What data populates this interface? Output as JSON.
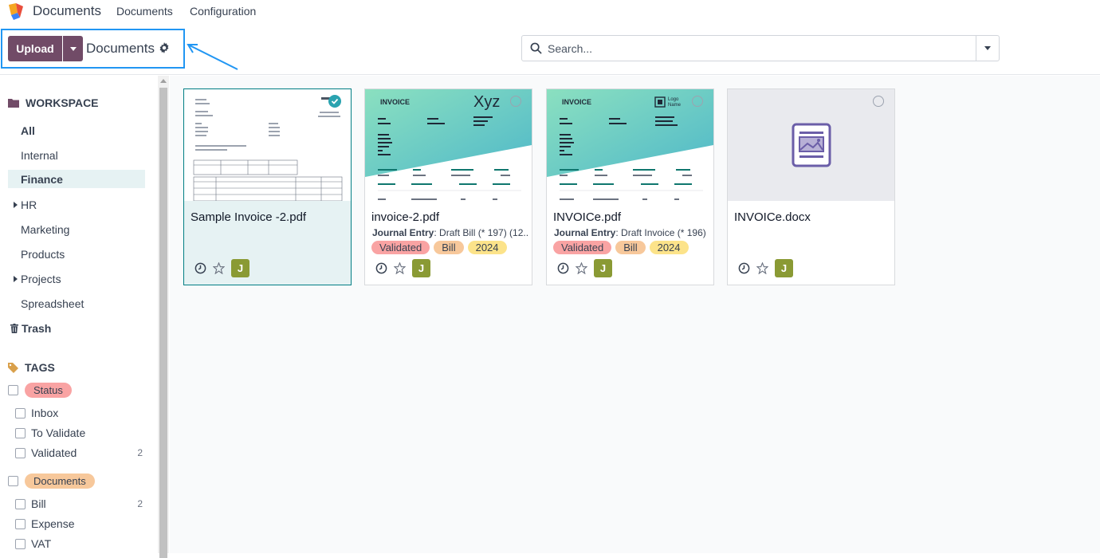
{
  "topbar": {
    "app_title": "Documents",
    "menu": [
      "Documents",
      "Configuration"
    ]
  },
  "control_panel": {
    "upload_label": "Upload",
    "breadcrumb_title": "Documents",
    "search_placeholder": "Search..."
  },
  "sidebar": {
    "workspace_heading": "WORKSPACE",
    "workspaces": [
      {
        "label": "All",
        "bold": true
      },
      {
        "label": "Internal"
      },
      {
        "label": "Finance",
        "active": true
      },
      {
        "label": "HR",
        "expandable": true
      },
      {
        "label": "Marketing"
      },
      {
        "label": "Products"
      },
      {
        "label": "Projects",
        "expandable": true
      },
      {
        "label": "Spreadsheet"
      }
    ],
    "trash_label": "Trash",
    "tags_heading": "TAGS",
    "tag_groups": [
      {
        "label": "Status",
        "color": "#f9a3a3",
        "items": [
          {
            "label": "Inbox",
            "count": ""
          },
          {
            "label": "To Validate",
            "count": ""
          },
          {
            "label": "Validated",
            "count": "2"
          }
        ]
      },
      {
        "label": "Documents",
        "color": "#f7c89b",
        "items": [
          {
            "label": "Bill",
            "count": "2"
          },
          {
            "label": "Expense",
            "count": ""
          },
          {
            "label": "VAT",
            "count": ""
          }
        ]
      }
    ]
  },
  "cards": [
    {
      "name": "Sample Invoice -2.pdf",
      "selected": true,
      "sub_label": "",
      "sub_value": "",
      "tags": [],
      "avatar": "J"
    },
    {
      "name": "invoice-2.pdf",
      "selected": false,
      "sub_label": "Journal Entry",
      "sub_value": ": Draft Bill (* 197) (12...",
      "tags": [
        "Validated",
        "Bill",
        "2024"
      ],
      "avatar": "J"
    },
    {
      "name": "INVOICe.pdf",
      "selected": false,
      "sub_label": "Journal Entry",
      "sub_value": ": Draft Invoice (* 196)",
      "tags": [
        "Validated",
        "Bill",
        "2024"
      ],
      "avatar": "J"
    },
    {
      "name": "INVOICe.docx",
      "selected": false,
      "sub_label": "",
      "sub_value": "",
      "tags": [],
      "avatar": "J"
    }
  ],
  "thumb_text": {
    "invoice_heading": "INVOICE",
    "xyz_brand": "Xyz",
    "logo_name": "Logo\nName"
  },
  "colors": {
    "brand": "#714b67",
    "highlight": "#2196f3",
    "selected_border": "#017e84",
    "tag_validated": "#f9a3a3",
    "tag_bill": "#f7c89b",
    "tag_year": "#fce38a",
    "avatar": "#8a9a34"
  }
}
